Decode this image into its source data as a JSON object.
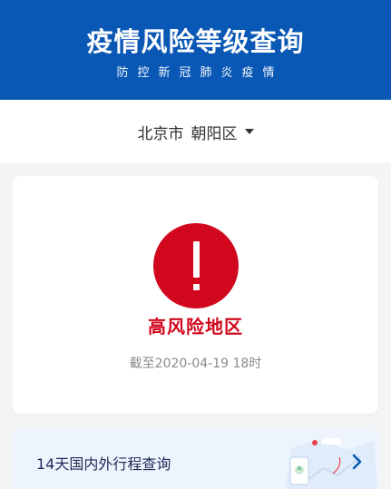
{
  "header": {
    "title": "疫情风险等级查询",
    "subtitle": "防控新冠肺炎疫情"
  },
  "location": {
    "city": "北京市",
    "district": "朝阳区"
  },
  "risk": {
    "level": "高风险地区",
    "as_of": "截至2020-04-19 18时",
    "color": "#d0071d"
  },
  "trip_query": {
    "label": "14天国内外行程查询"
  },
  "colors": {
    "header_bg": "#0a58b5",
    "risk_red": "#d0071d",
    "page_bg": "#f3f4f6",
    "trip_card_bg": "#edf4fd"
  }
}
